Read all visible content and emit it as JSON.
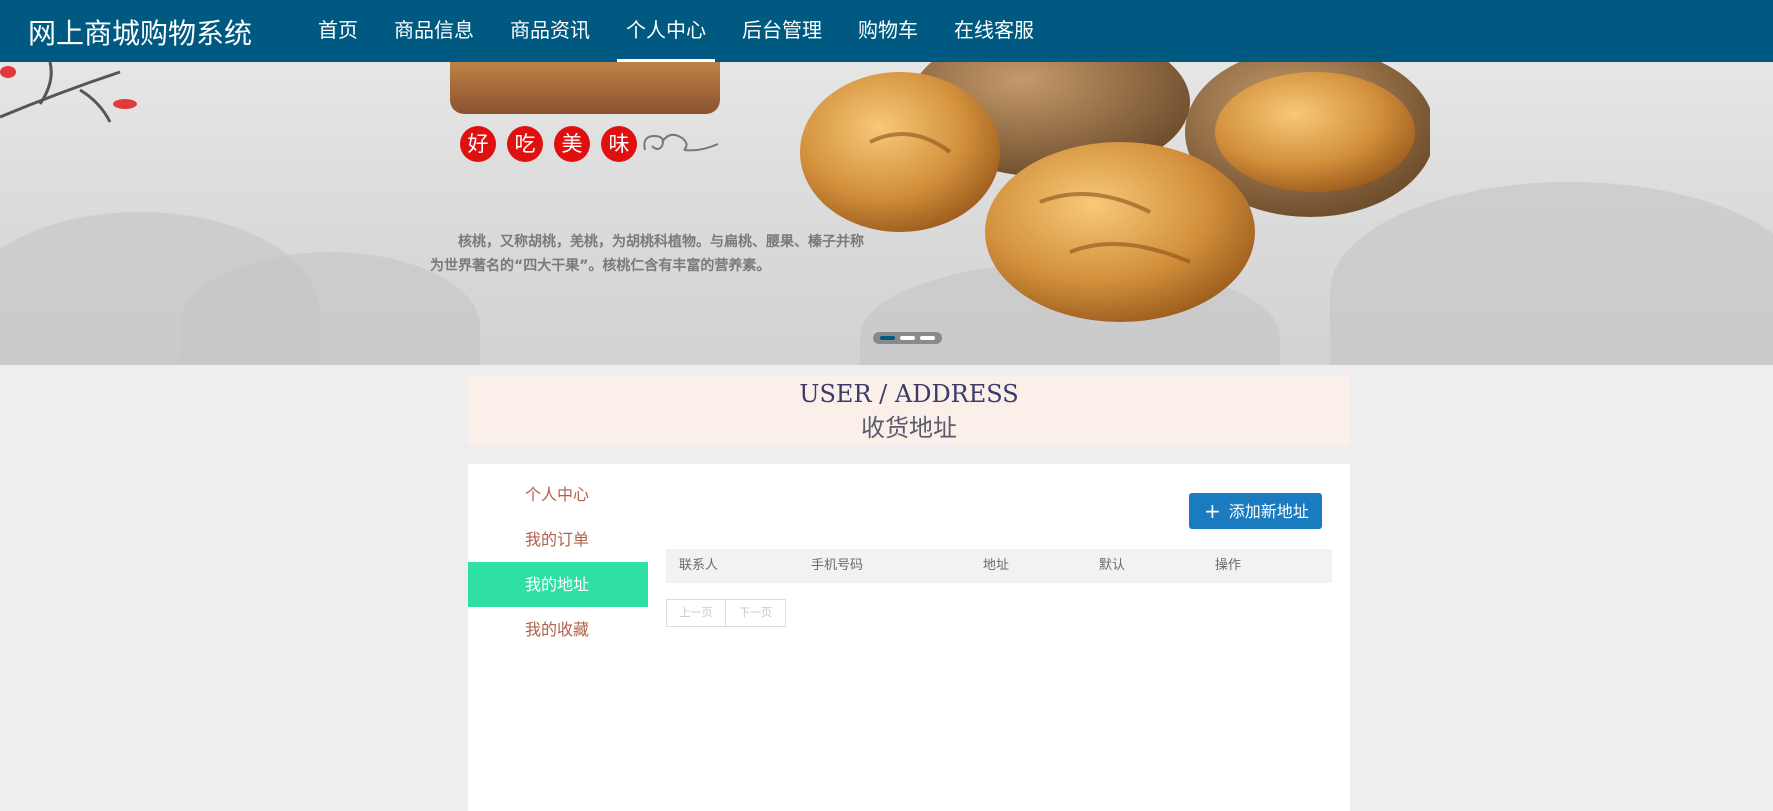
{
  "header": {
    "brand": "网上商城购物系统",
    "nav": [
      "首页",
      "商品信息",
      "商品资讯",
      "个人中心",
      "后台管理",
      "购物车",
      "在线客服"
    ],
    "active_nav": "个人中心"
  },
  "banner": {
    "badges": [
      "好",
      "吃",
      "美",
      "味"
    ],
    "description": "核桃，又称胡桃，羌桃，为胡桃科植物。与扁桃、腰果、榛子并称为世界著名的“四大干果”。核桃仁含有丰富的营养素。",
    "slides_total": 3,
    "active_slide_index": 0
  },
  "section": {
    "title_en": "USER / ADDRESS",
    "title_cn": "收货地址"
  },
  "sidebar": {
    "items": [
      {
        "label": "个人中心"
      },
      {
        "label": "我的订单"
      },
      {
        "label": "我的地址"
      },
      {
        "label": "我的收藏"
      }
    ],
    "active_label": "我的地址"
  },
  "address_list": {
    "add_button": "添加新地址",
    "columns": [
      "联系人",
      "手机号码",
      "地址",
      "默认",
      "操作"
    ],
    "rows": [],
    "pager": {
      "prev": "上一页",
      "next": "下一页"
    }
  },
  "colors": {
    "header_bg": "#005980",
    "sidebar_active_bg": "#2ee0a3",
    "add_button_bg": "#1b7bbf",
    "section_bg": "#fbefe9",
    "badge_red": "#e01010"
  },
  "icons": {
    "add": "plus-icon"
  }
}
